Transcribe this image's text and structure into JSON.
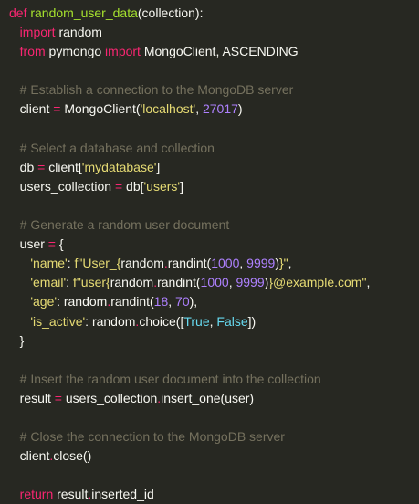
{
  "colors": {
    "background": "#272822",
    "keyword": "#f92672",
    "function": "#a6e22e",
    "string": "#e6db74",
    "number": "#ae81ff",
    "comment": "#75715e",
    "constant": "#66d9ef",
    "plain": "#f8f8f2"
  },
  "lines": [
    [
      [
        "kw",
        "def"
      ],
      [
        "pl",
        " "
      ],
      [
        "fn",
        "random_user_data"
      ],
      [
        "pl",
        "(collection):"
      ]
    ],
    [
      [
        "pl",
        "   "
      ],
      [
        "kw",
        "import"
      ],
      [
        "pl",
        " random"
      ]
    ],
    [
      [
        "pl",
        "   "
      ],
      [
        "kw",
        "from"
      ],
      [
        "pl",
        " pymongo "
      ],
      [
        "kw",
        "import"
      ],
      [
        "pl",
        " MongoClient, ASCENDING"
      ]
    ],
    [],
    [
      [
        "pl",
        "   "
      ],
      [
        "cm",
        "# Establish a connection to the MongoDB server"
      ]
    ],
    [
      [
        "pl",
        "   client "
      ],
      [
        "kw",
        "="
      ],
      [
        "pl",
        " MongoClient("
      ],
      [
        "str",
        "'localhost'"
      ],
      [
        "pl",
        ", "
      ],
      [
        "num",
        "27017"
      ],
      [
        "pl",
        ")"
      ]
    ],
    [],
    [
      [
        "pl",
        "   "
      ],
      [
        "cm",
        "# Select a database and collection"
      ]
    ],
    [
      [
        "pl",
        "   db "
      ],
      [
        "kw",
        "="
      ],
      [
        "pl",
        " client["
      ],
      [
        "str",
        "'mydatabase'"
      ],
      [
        "pl",
        "]"
      ]
    ],
    [
      [
        "pl",
        "   users_collection "
      ],
      [
        "kw",
        "="
      ],
      [
        "pl",
        " db["
      ],
      [
        "str",
        "'users'"
      ],
      [
        "pl",
        "]"
      ]
    ],
    [],
    [
      [
        "pl",
        "   "
      ],
      [
        "cm",
        "# Generate a random user document"
      ]
    ],
    [
      [
        "pl",
        "   user "
      ],
      [
        "kw",
        "="
      ],
      [
        "pl",
        " {"
      ]
    ],
    [
      [
        "pl",
        "      "
      ],
      [
        "str",
        "'name'"
      ],
      [
        "pl",
        ": "
      ],
      [
        "str",
        "f\"User_{"
      ],
      [
        "pl",
        "random"
      ],
      [
        "kw",
        "."
      ],
      [
        "pl",
        "randint("
      ],
      [
        "num",
        "1000"
      ],
      [
        "pl",
        ", "
      ],
      [
        "num",
        "9999"
      ],
      [
        "pl",
        ")"
      ],
      [
        "str",
        "}\""
      ],
      [
        "pl",
        ","
      ]
    ],
    [
      [
        "pl",
        "      "
      ],
      [
        "str",
        "'email'"
      ],
      [
        "pl",
        ": "
      ],
      [
        "str",
        "f\"user{"
      ],
      [
        "pl",
        "random"
      ],
      [
        "kw",
        "."
      ],
      [
        "pl",
        "randint("
      ],
      [
        "num",
        "1000"
      ],
      [
        "pl",
        ", "
      ],
      [
        "num",
        "9999"
      ],
      [
        "pl",
        ")"
      ],
      [
        "str",
        "}@example.com\""
      ],
      [
        "pl",
        ","
      ]
    ],
    [
      [
        "pl",
        "      "
      ],
      [
        "str",
        "'age'"
      ],
      [
        "pl",
        ": random"
      ],
      [
        "kw",
        "."
      ],
      [
        "pl",
        "randint("
      ],
      [
        "num",
        "18"
      ],
      [
        "pl",
        ", "
      ],
      [
        "num",
        "70"
      ],
      [
        "pl",
        "),"
      ]
    ],
    [
      [
        "pl",
        "      "
      ],
      [
        "str",
        "'is_active'"
      ],
      [
        "pl",
        ": random"
      ],
      [
        "kw",
        "."
      ],
      [
        "pl",
        "choice(["
      ],
      [
        "cn",
        "True"
      ],
      [
        "pl",
        ", "
      ],
      [
        "cn",
        "False"
      ],
      [
        "pl",
        "])"
      ]
    ],
    [
      [
        "pl",
        "   }"
      ]
    ],
    [],
    [
      [
        "pl",
        "   "
      ],
      [
        "cm",
        "# Insert the random user document into the collection"
      ]
    ],
    [
      [
        "pl",
        "   result "
      ],
      [
        "kw",
        "="
      ],
      [
        "pl",
        " users_collection"
      ],
      [
        "kw",
        "."
      ],
      [
        "pl",
        "insert_one(user)"
      ]
    ],
    [],
    [
      [
        "pl",
        "   "
      ],
      [
        "cm",
        "# Close the connection to the MongoDB server"
      ]
    ],
    [
      [
        "pl",
        "   client"
      ],
      [
        "kw",
        "."
      ],
      [
        "pl",
        "close()"
      ]
    ],
    [],
    [
      [
        "pl",
        "   "
      ],
      [
        "kw",
        "return"
      ],
      [
        "pl",
        " result"
      ],
      [
        "kw",
        "."
      ],
      [
        "pl",
        "inserted_id"
      ]
    ]
  ]
}
